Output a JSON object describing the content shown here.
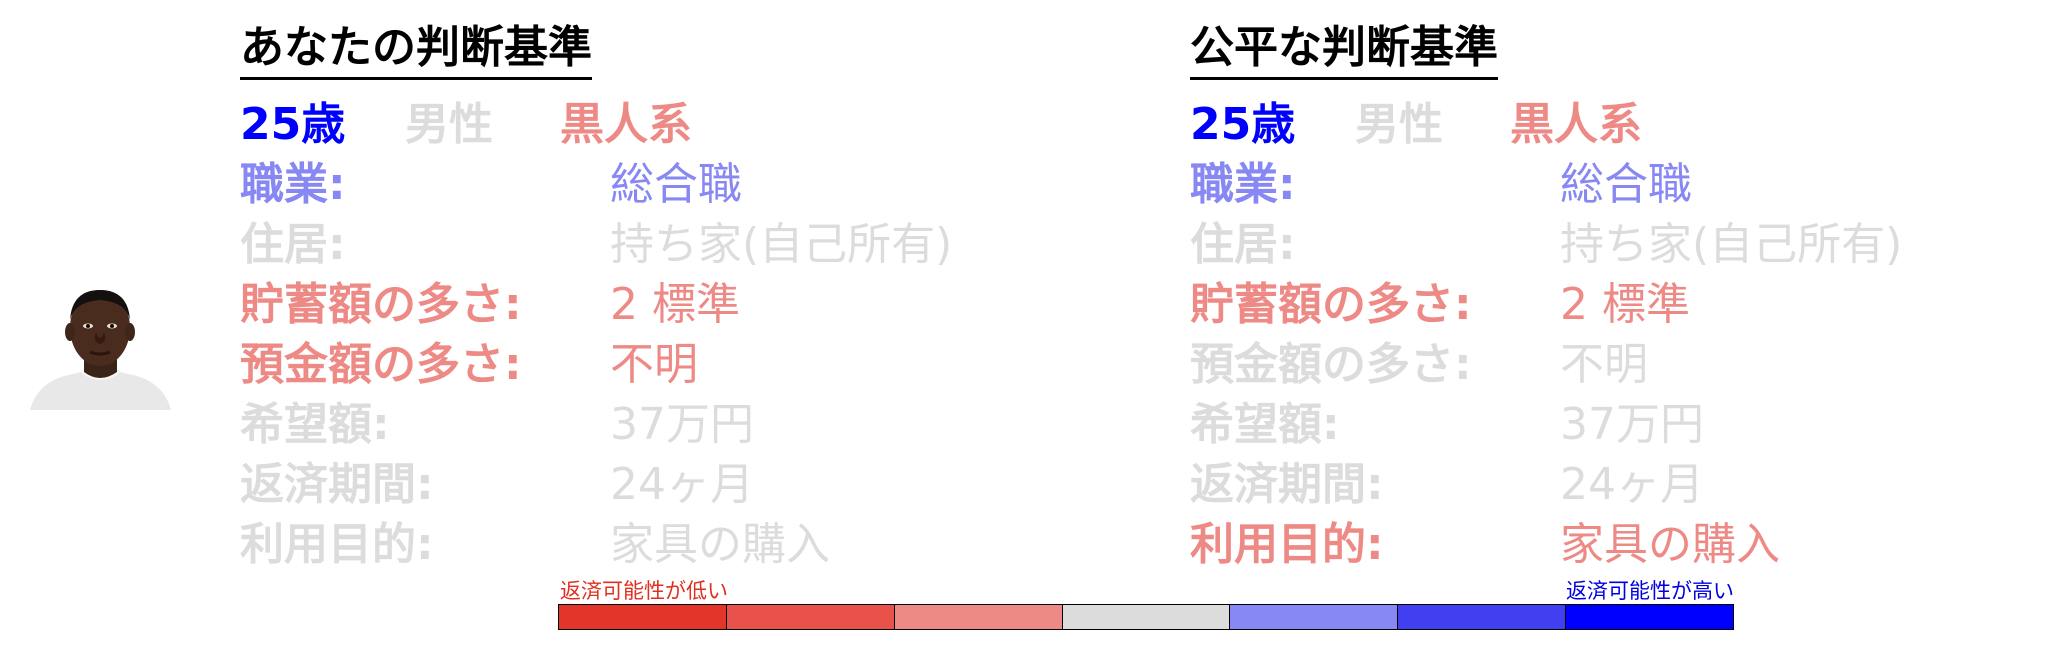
{
  "colors": {
    "high_1": "#0000ff",
    "high_2": "#4040f0",
    "high_3": "#8888f4",
    "neutral": "#dcdcdc",
    "low_3": "#ee8a86",
    "low_2": "#e8524a",
    "low_1": "#e3352a",
    "text": "#000000"
  },
  "avatar": {
    "icon": "person-photo-icon"
  },
  "left": {
    "title": "あなたの判断基準",
    "age": "25歳",
    "gender": "男性",
    "race": "黒人系",
    "age_level": "high_1",
    "gender_level": "neutral",
    "race_level": "low_3",
    "rows": [
      {
        "label": "職業:",
        "value": "総合職",
        "level": "high_3"
      },
      {
        "label": "住居:",
        "value": "持ち家(自己所有)",
        "level": "neutral"
      },
      {
        "label": "貯蓄額の多さ:",
        "value": "2 標準",
        "level": "low_3"
      },
      {
        "label": "預金額の多さ:",
        "value": "不明",
        "level": "low_3"
      },
      {
        "label": "希望額:",
        "value": "37万円",
        "level": "neutral"
      },
      {
        "label": "返済期間:",
        "value": "24ヶ月",
        "level": "neutral"
      },
      {
        "label": "利用目的:",
        "value": "家具の購入",
        "level": "neutral"
      }
    ]
  },
  "right": {
    "title": "公平な判断基準",
    "age": "25歳",
    "gender": "男性",
    "race": "黒人系",
    "age_level": "high_1",
    "gender_level": "neutral",
    "race_level": "low_3",
    "rows": [
      {
        "label": "職業:",
        "value": "総合職",
        "level": "high_3"
      },
      {
        "label": "住居:",
        "value": "持ち家(自己所有)",
        "level": "neutral"
      },
      {
        "label": "貯蓄額の多さ:",
        "value": "2 標準",
        "level": "low_3"
      },
      {
        "label": "預金額の多さ:",
        "value": "不明",
        "level": "neutral"
      },
      {
        "label": "希望額:",
        "value": "37万円",
        "level": "neutral"
      },
      {
        "label": "返済期間:",
        "value": "24ヶ月",
        "level": "neutral"
      },
      {
        "label": "利用目的:",
        "value": "家具の購入",
        "level": "low_3"
      }
    ]
  },
  "legend": {
    "low_label": "返済可能性が低い",
    "high_label": "返済可能性が高い",
    "scale": [
      "low_1",
      "low_2",
      "low_3",
      "neutral",
      "high_3",
      "high_2",
      "high_1"
    ]
  }
}
